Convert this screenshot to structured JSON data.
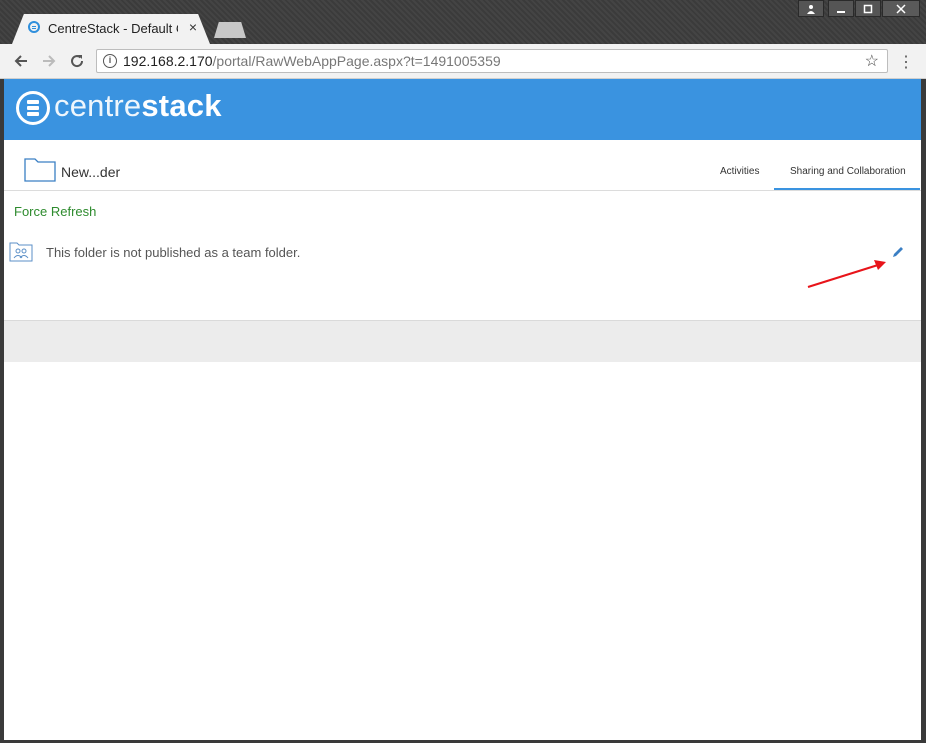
{
  "browser": {
    "tab_title": "CentreStack - Default Client",
    "tab_close": "×",
    "url_host": "192.168.2.170",
    "url_path": "/portal/RawWebAppPage.aspx?t=1491005359",
    "window_buttons": [
      "user",
      "minimize",
      "maximize",
      "close"
    ]
  },
  "brand": {
    "logo_light": "centre",
    "logo_bold": "stack",
    "color": "#3a93e0"
  },
  "folder": {
    "name": "New...der"
  },
  "tabs": [
    {
      "label": "Activities",
      "active": false
    },
    {
      "label": "Sharing and Collaboration",
      "active": true
    }
  ],
  "actions": {
    "force_refresh": "Force Refresh"
  },
  "team_folder": {
    "status": "This folder is not published as a team folder.",
    "edit_icon": "pencil-icon"
  },
  "annotation": {
    "arrow_color": "#e8141a"
  }
}
